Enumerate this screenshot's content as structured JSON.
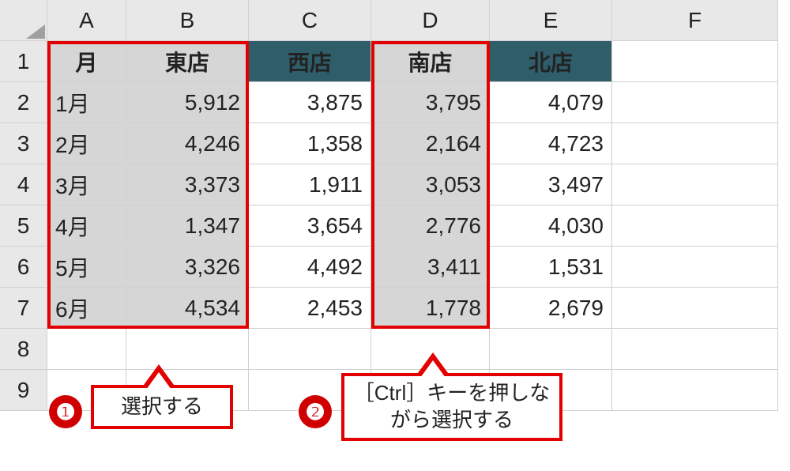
{
  "columns": [
    "A",
    "B",
    "C",
    "D",
    "E",
    "F"
  ],
  "rows": [
    "1",
    "2",
    "3",
    "4",
    "5",
    "6",
    "7",
    "8",
    "9"
  ],
  "headers": {
    "month": "月",
    "east": "東店",
    "west": "西店",
    "south": "南店",
    "north": "北店"
  },
  "data": [
    {
      "month": "1月",
      "east": "5,912",
      "west": "3,875",
      "south": "3,795",
      "north": "4,079"
    },
    {
      "month": "2月",
      "east": "4,246",
      "west": "1,358",
      "south": "2,164",
      "north": "4,723"
    },
    {
      "month": "3月",
      "east": "3,373",
      "west": "1,911",
      "south": "3,053",
      "north": "3,497"
    },
    {
      "month": "4月",
      "east": "1,347",
      "west": "3,654",
      "south": "2,776",
      "north": "4,030"
    },
    {
      "month": "5月",
      "east": "3,326",
      "west": "4,492",
      "south": "3,411",
      "north": "1,531"
    },
    {
      "month": "6月",
      "east": "4,534",
      "west": "2,453",
      "south": "1,778",
      "north": "2,679"
    }
  ],
  "annotations": {
    "badge1": "❶",
    "badge2": "❷",
    "callout1": "選択する",
    "callout2": "［Ctrl］キーを押しながら選択する"
  }
}
